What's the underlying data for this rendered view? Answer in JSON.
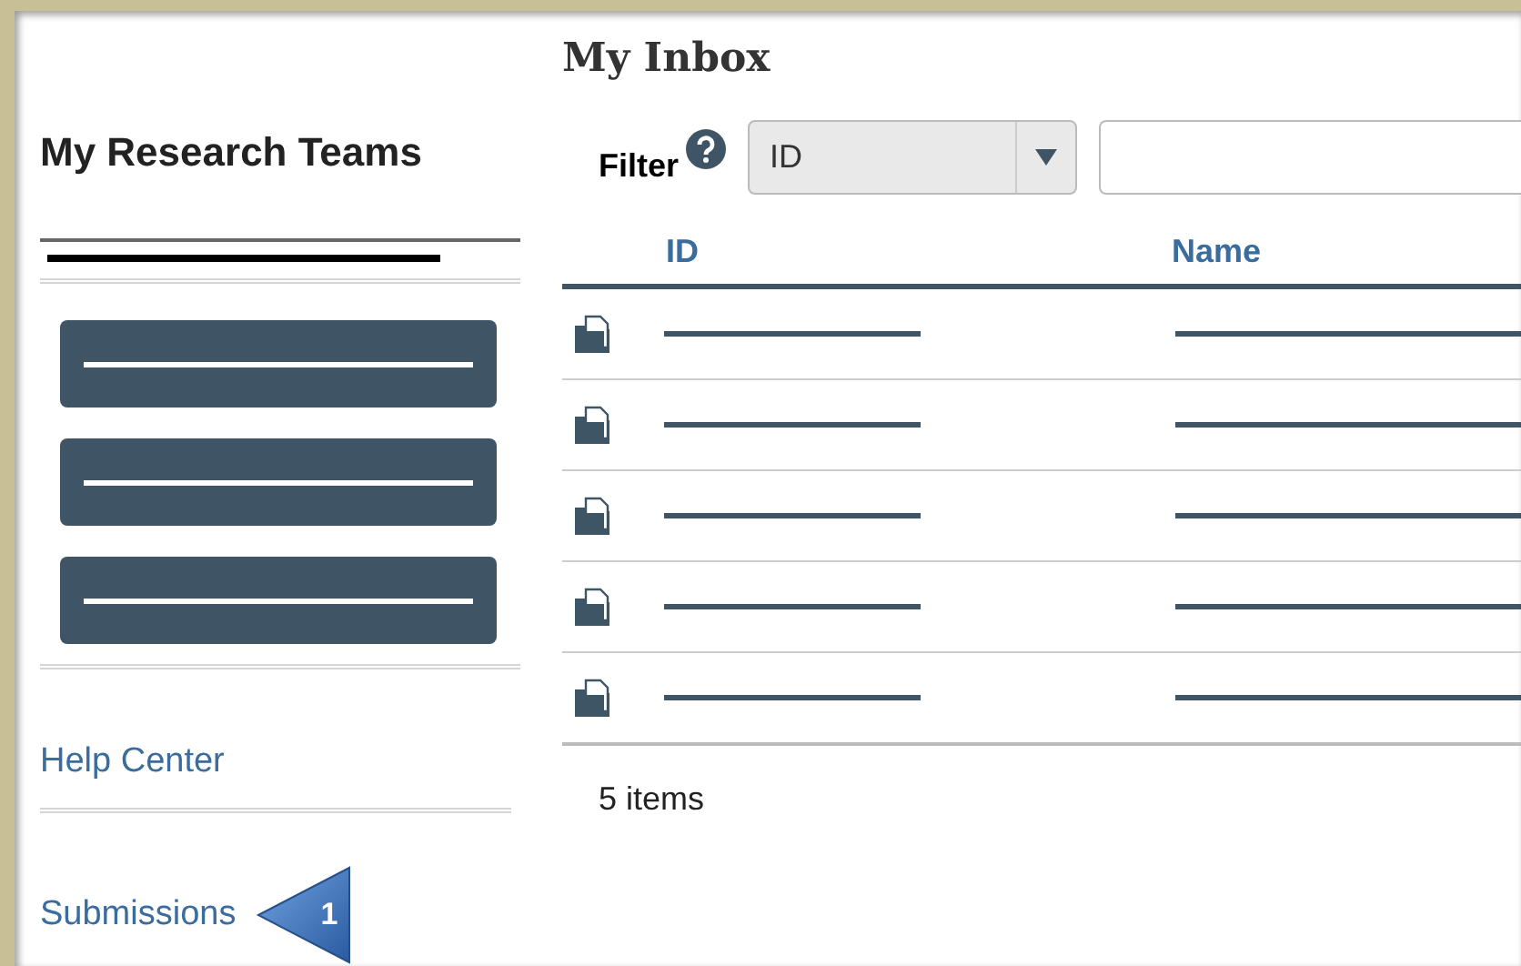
{
  "sidebar": {
    "title": "My Research Teams",
    "team": {
      "kind": "redacted"
    },
    "buttons": [
      {
        "kind": "redacted"
      },
      {
        "kind": "redacted"
      },
      {
        "kind": "redacted"
      }
    ],
    "links": [
      "Help Center",
      "Submissions"
    ]
  },
  "callout": {
    "label": "1"
  },
  "inbox": {
    "title": "My Inbox",
    "filter": {
      "label": "Filter",
      "select_value": "ID"
    },
    "columns": [
      "ID",
      "Name"
    ],
    "rows": [
      {
        "kind": "document"
      },
      {
        "kind": "document"
      },
      {
        "kind": "document"
      },
      {
        "kind": "document"
      },
      {
        "kind": "document"
      }
    ],
    "footer": "5 items"
  }
}
